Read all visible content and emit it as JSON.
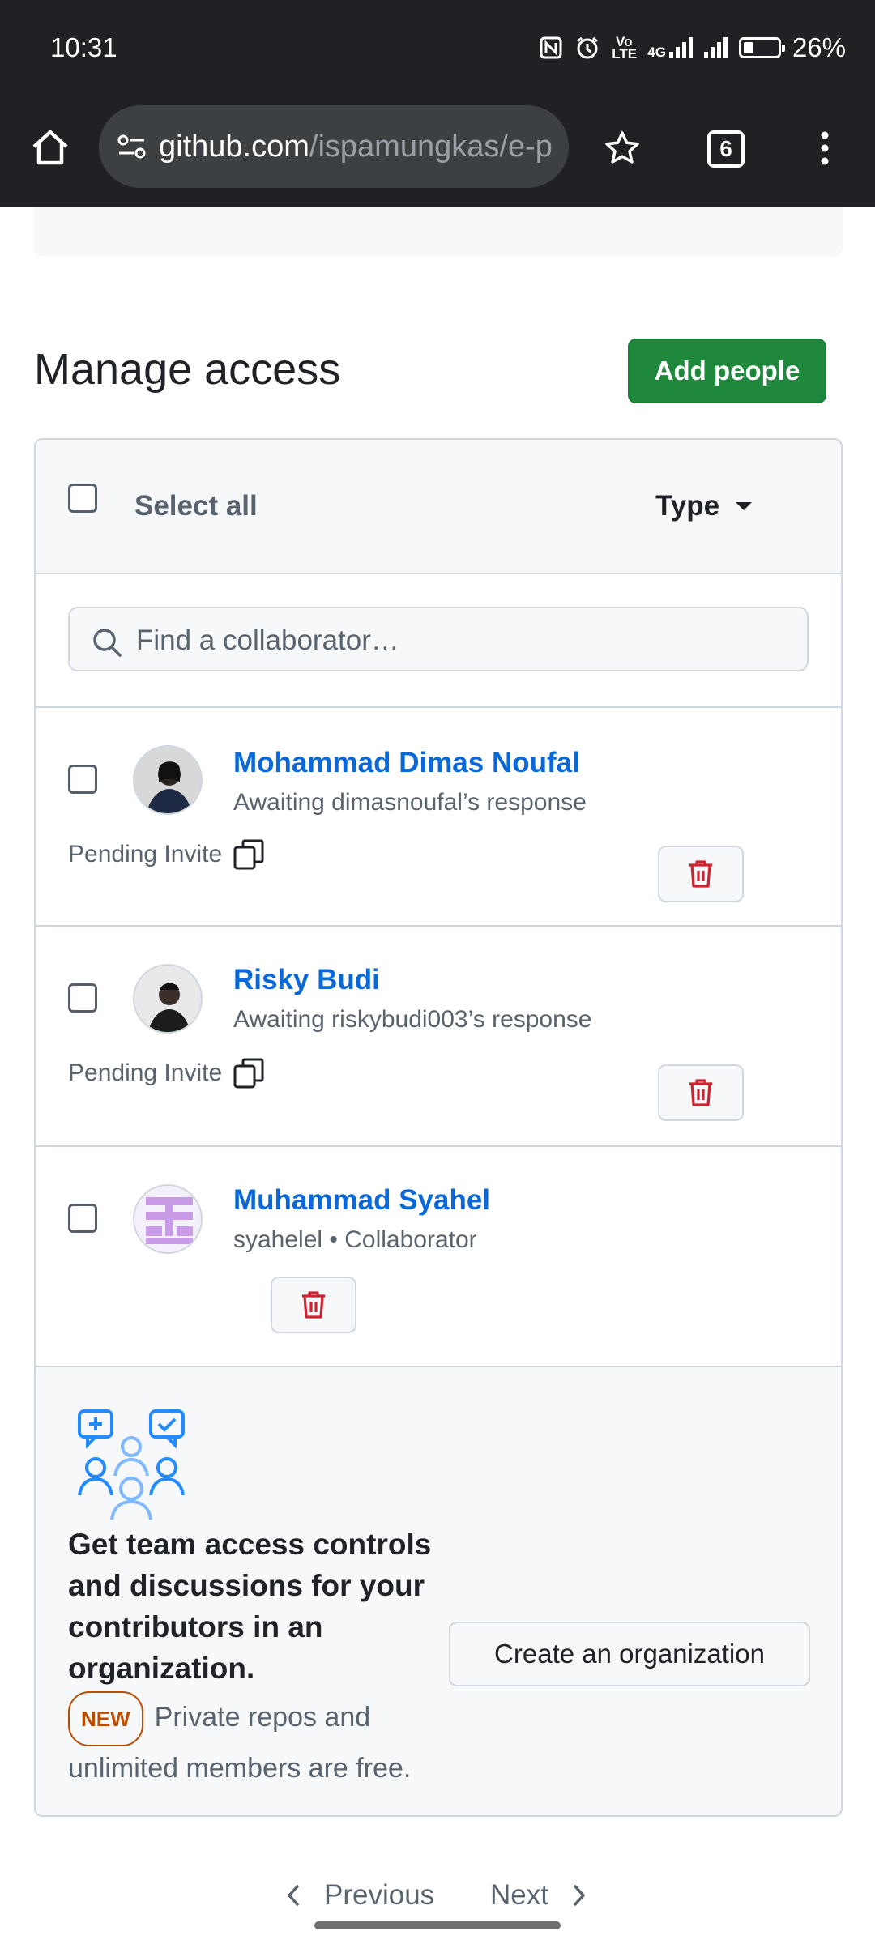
{
  "status_bar": {
    "time": "10:31",
    "battery": "26%",
    "network_label": "Vo LTE",
    "network_type": "4G"
  },
  "browser": {
    "url_host": "github.com",
    "url_path": "/ispamungkas/e-p",
    "tab_count": "6"
  },
  "page": {
    "title": "Manage access",
    "add_button": "Add people",
    "select_all": "Select all",
    "type_filter": "Type",
    "search_placeholder": "Find a collaborator…"
  },
  "collaborators": [
    {
      "name": "Mohammad Dimas Noufal",
      "subtitle": "Awaiting dimasnoufal’s response",
      "status": "Pending Invite"
    },
    {
      "name": "Risky Budi",
      "subtitle": "Awaiting riskybudi003’s response",
      "status": "Pending Invite"
    },
    {
      "name": "Muhammad Syahel",
      "subtitle": "syahelel • Collaborator"
    }
  ],
  "promo": {
    "heading": "Get team access controls and discussions for your contributors in an organization.",
    "badge": "NEW",
    "description": "Private repos and unlimited members are free.",
    "button": "Create an organization"
  },
  "pagination": {
    "previous": "Previous",
    "next": "Next"
  },
  "colors": {
    "primary_button": "#1f883d",
    "link": "#0969da",
    "danger": "#cf222e",
    "new_badge": "#bc4c00"
  }
}
